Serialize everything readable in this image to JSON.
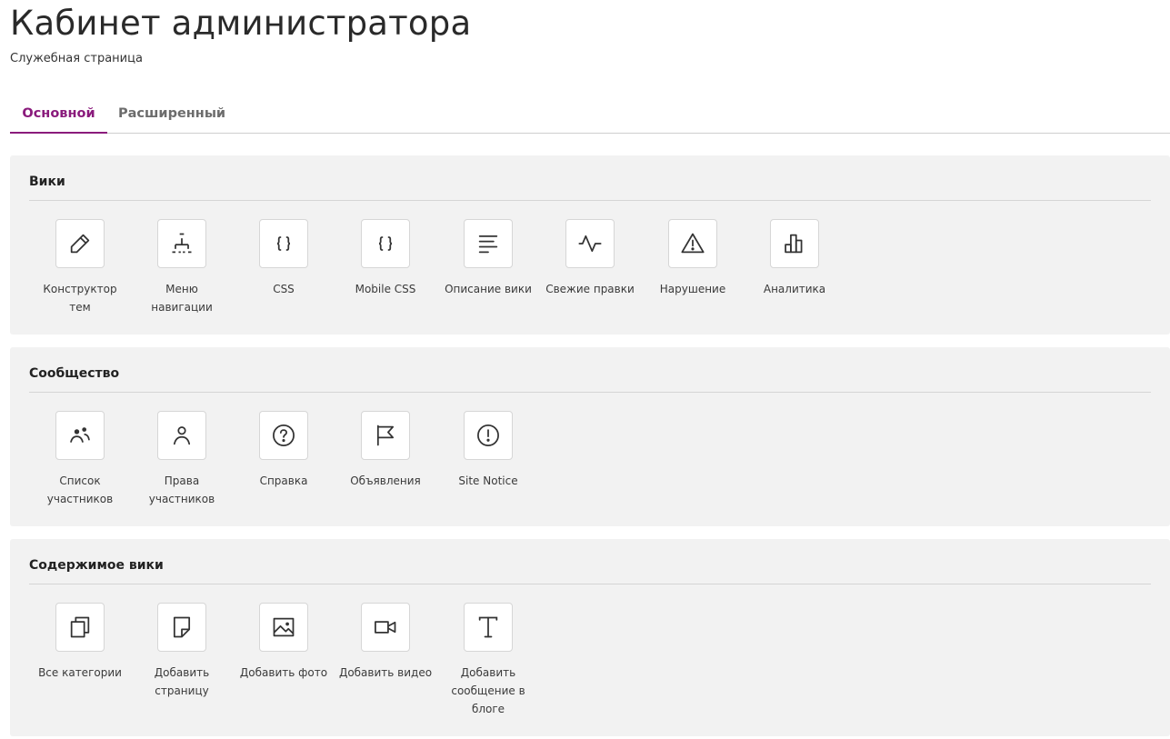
{
  "header": {
    "title": "Кабинет администратора",
    "subtitle": "Служебная страница"
  },
  "tabs": [
    {
      "label": "Основной",
      "active": true
    },
    {
      "label": "Расширенный",
      "active": false
    }
  ],
  "accent_color": "#8a1b7c",
  "sections": [
    {
      "title": "Вики",
      "items": [
        {
          "label": "Конструктор тем",
          "icon": "pencil-icon"
        },
        {
          "label": "Меню навигации",
          "icon": "sitemap-icon"
        },
        {
          "label": "CSS",
          "icon": "braces-icon"
        },
        {
          "label": "Mobile CSS",
          "icon": "braces-icon"
        },
        {
          "label": "Описание вики",
          "icon": "text-lines-icon"
        },
        {
          "label": "Свежие правки",
          "icon": "activity-icon"
        },
        {
          "label": "Нарушение",
          "icon": "warning-icon"
        },
        {
          "label": "Аналитика",
          "icon": "bar-chart-icon"
        }
      ]
    },
    {
      "title": "Сообщество",
      "items": [
        {
          "label": "Список участников",
          "icon": "users-icon"
        },
        {
          "label": "Права участников",
          "icon": "user-icon"
        },
        {
          "label": "Справка",
          "icon": "question-icon"
        },
        {
          "label": "Объявления",
          "icon": "flag-icon"
        },
        {
          "label": "Site Notice",
          "icon": "exclamation-icon"
        }
      ]
    },
    {
      "title": "Содержимое вики",
      "items": [
        {
          "label": "Все категории",
          "icon": "copy-icon"
        },
        {
          "label": "Добавить страницу",
          "icon": "page-icon"
        },
        {
          "label": "Добавить фото",
          "icon": "image-icon"
        },
        {
          "label": "Добавить видео",
          "icon": "video-icon"
        },
        {
          "label": "Добавить сообщение в блоге",
          "icon": "type-icon"
        }
      ]
    }
  ]
}
